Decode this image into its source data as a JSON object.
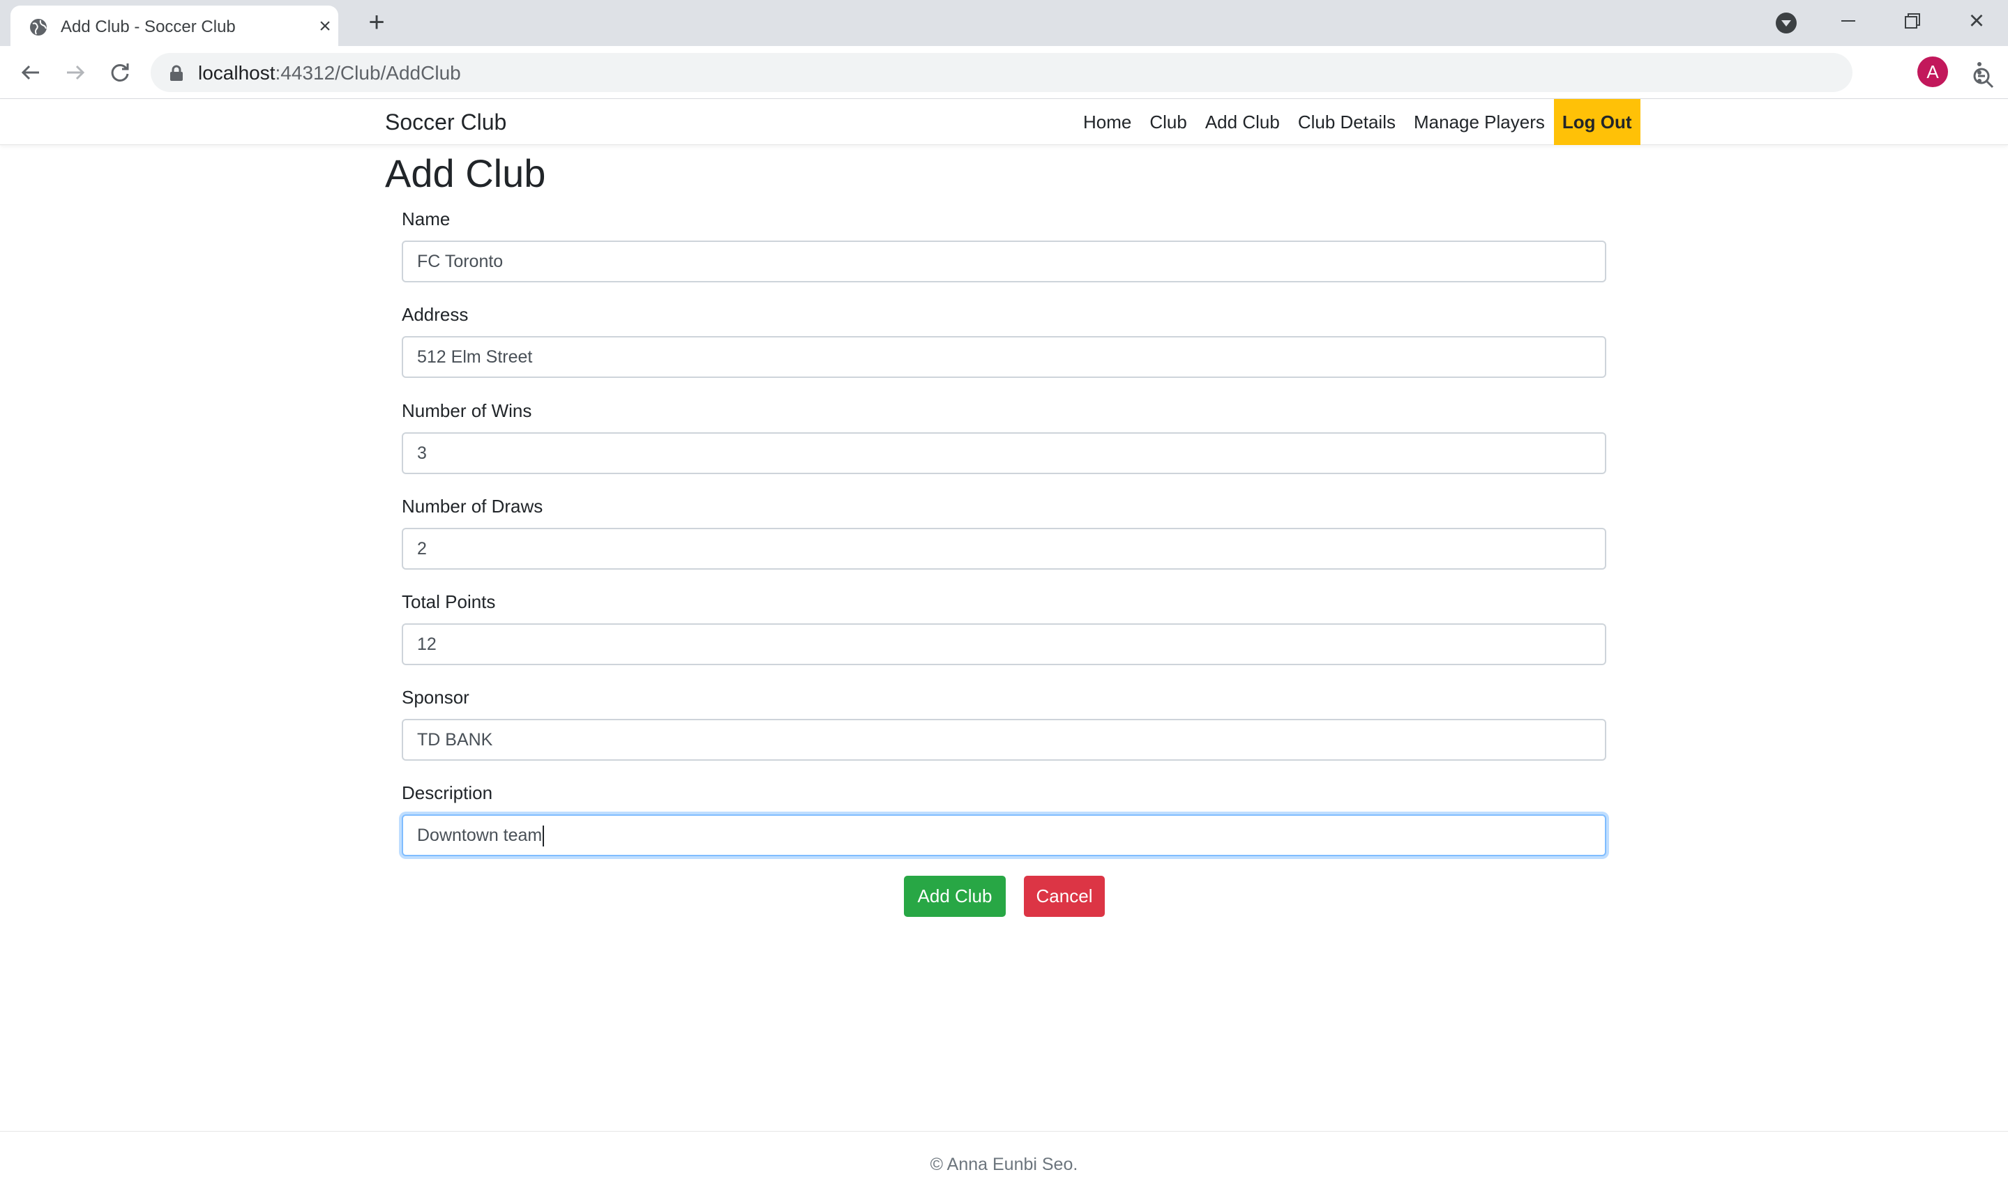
{
  "browser": {
    "tab_title": "Add Club - Soccer Club",
    "url_host": "localhost",
    "url_path": ":44312/Club/AddClub",
    "profile_initial": "A"
  },
  "site": {
    "brand": "Soccer Club",
    "nav": [
      {
        "label": "Home"
      },
      {
        "label": "Club"
      },
      {
        "label": "Add Club"
      },
      {
        "label": "Club Details"
      },
      {
        "label": "Manage Players"
      },
      {
        "label": "Log Out"
      }
    ]
  },
  "form": {
    "title": "Add Club",
    "fields": [
      {
        "label": "Name",
        "value": "FC Toronto"
      },
      {
        "label": "Address",
        "value": "512 Elm Street"
      },
      {
        "label": "Number of Wins",
        "value": "3"
      },
      {
        "label": "Number of Draws",
        "value": "2"
      },
      {
        "label": "Total Points",
        "value": "12"
      },
      {
        "label": "Sponsor",
        "value": "TD BANK"
      },
      {
        "label": "Description",
        "value": "Downtown team",
        "focused": true
      }
    ],
    "submit_label": "Add Club",
    "cancel_label": "Cancel"
  },
  "footer": {
    "text": "© Anna Eunbi Seo."
  },
  "colors": {
    "success": "#28a745",
    "danger": "#dc3545",
    "warning": "#ffc107",
    "focus": "#80bdff"
  }
}
